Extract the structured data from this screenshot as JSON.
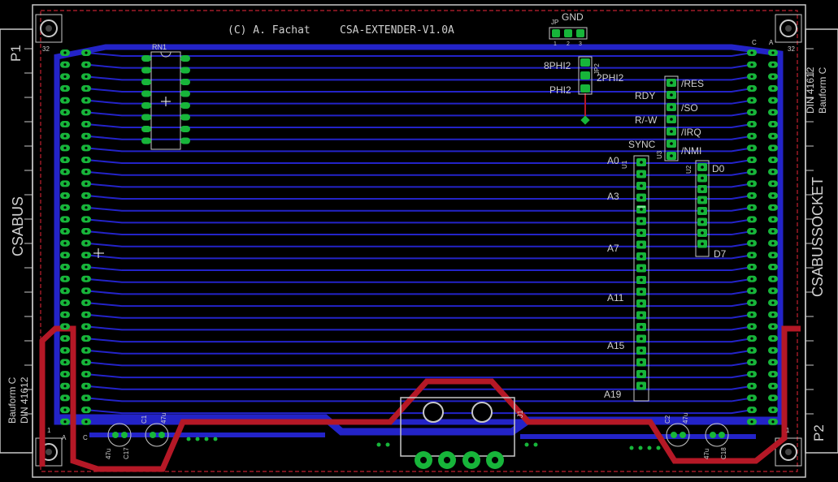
{
  "board": {
    "copyright": "(C) A. Fachat",
    "title": "CSA-EXTENDER-V1.0A"
  },
  "connectors": {
    "p1": {
      "name": "P1",
      "label": "CSABUS",
      "standard": "DIN 41612",
      "form": "Bauform C",
      "row_a": "A",
      "row_c": "C",
      "pin_top": "32",
      "pin_bottom": "1"
    },
    "p2": {
      "name": "P2",
      "label": "CSABUSSOCKET",
      "standard": "DIN 41612",
      "form": "Bauform C",
      "row_a": "A",
      "row_c": "C",
      "pin_top": "32",
      "pin_bottom": "1"
    }
  },
  "components": {
    "rn1": "RN1",
    "jp": "JP",
    "jp2": "JP2",
    "u3": "U3",
    "u1": "U1",
    "u2": "U2",
    "j1": "J1",
    "c1": "C1",
    "c2": "C2",
    "c17": "C17",
    "c18": "C18",
    "cap_value": "47u"
  },
  "jumper_gnd": {
    "label": "GND",
    "pins": [
      "1",
      "2",
      "3"
    ]
  },
  "clock_pins": [
    "8PHI2",
    "2PHI2",
    "PHI2"
  ],
  "control_pins": [
    "/RES",
    "RDY",
    "/SO",
    "R/-W",
    "/IRQ",
    "SYNC",
    "/NMI"
  ],
  "address_labels": [
    "A0",
    "A3",
    "A7",
    "A11",
    "A15",
    "A19"
  ],
  "data_labels": [
    "D0",
    "D7"
  ],
  "colors": {
    "background": "#000000",
    "top_copper": "#2323c8",
    "bottom_copper": "#b51826",
    "pads": "#17b53a",
    "silkscreen": "#d0d0d0",
    "outline": "#c02030"
  }
}
